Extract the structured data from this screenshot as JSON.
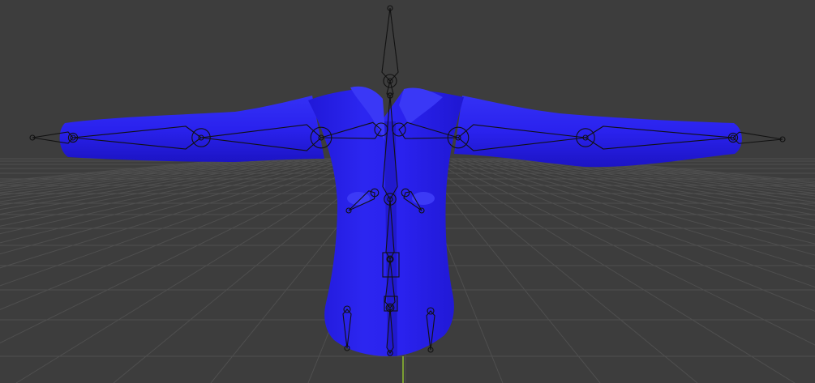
{
  "app": {
    "view": "3d-viewport"
  },
  "scene": {
    "background_color": "#3d3d3d",
    "grid_color": "#4f4f4f",
    "y_axis_color": "#8fbf2f",
    "mesh": {
      "object": "shirt",
      "color": "#2a22ee",
      "shade_color": "#1b12b0",
      "highlight_color": "#4b48ff"
    },
    "armature": {
      "object": "armature",
      "display": "octahedral",
      "color": "#111111",
      "bones": [
        "head",
        "neck",
        "spine-upper",
        "spine-mid",
        "spine-lower",
        "pelvis",
        "shoulder-left",
        "upper-arm-left",
        "forearm-left",
        "hand-left",
        "shoulder-right",
        "upper-arm-right",
        "forearm-right",
        "hand-right",
        "chest-left",
        "chest-right",
        "hip-left",
        "hip-right"
      ]
    }
  }
}
